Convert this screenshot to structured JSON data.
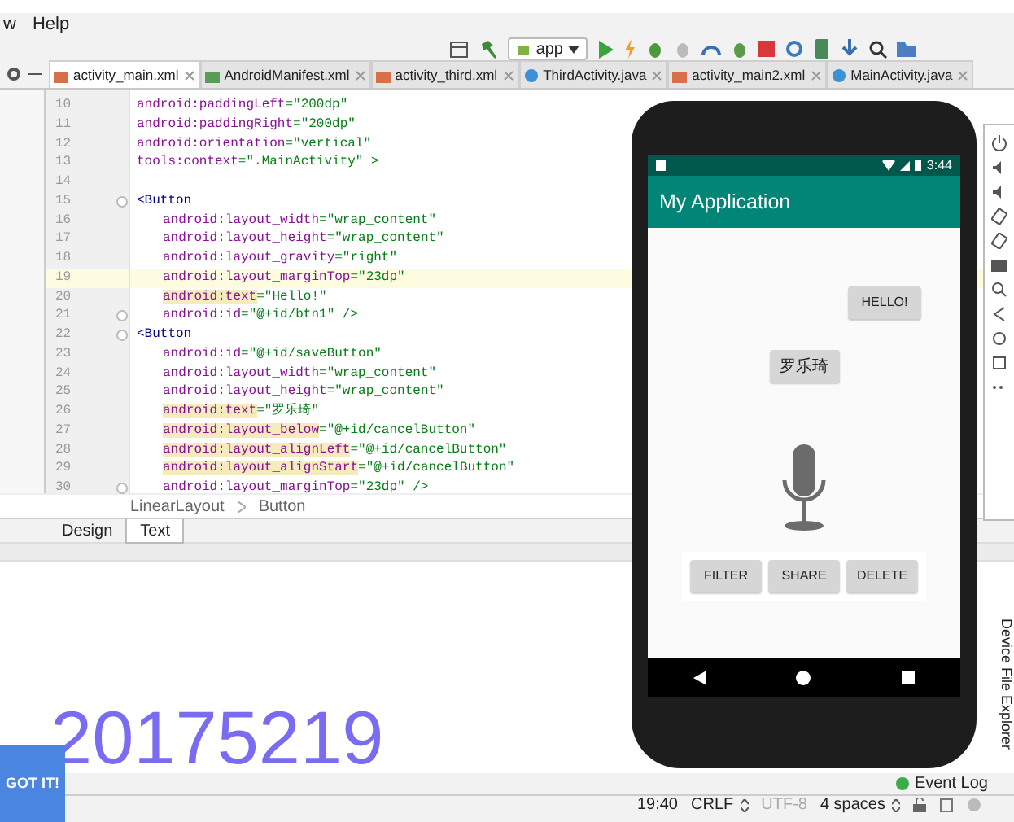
{
  "menu": [
    "w",
    "Help"
  ],
  "toolbar": {
    "run_config": "app"
  },
  "tabs": [
    {
      "label": "activity_main.xml",
      "kind": "layout",
      "selected": true
    },
    {
      "label": "AndroidManifest.xml",
      "kind": "manifest",
      "selected": false
    },
    {
      "label": "activity_third.xml",
      "kind": "layout",
      "selected": false
    },
    {
      "label": "ThirdActivity.java",
      "kind": "class",
      "selected": false
    },
    {
      "label": "activity_main2.xml",
      "kind": "layout",
      "selected": false
    },
    {
      "label": "MainActivity.java",
      "kind": "class",
      "selected": false
    }
  ],
  "code": [
    {
      "number": "10",
      "attr": "android:paddingLeft",
      "value": "=\"200dp\"",
      "current": false,
      "warning": false,
      "fold": false
    },
    {
      "number": "11",
      "attr": "android:paddingRight",
      "value": "=\"200dp\"",
      "current": false,
      "warning": false,
      "fold": false
    },
    {
      "number": "12",
      "attr": "android:orientation",
      "value": "=\"vertical\"",
      "current": false,
      "warning": false,
      "fold": false
    },
    {
      "number": "13",
      "attr": "tools:context",
      "value": "=\".MainActivity\" >",
      "current": false,
      "warning": false,
      "fold": false
    },
    {
      "number": "14"
    },
    {
      "number": "15",
      "tag": "<Button",
      "current": false,
      "warning": false,
      "fold": true,
      "children": [
        {
          "number": "16",
          "attr": "android:layout_width",
          "value": "=\"wrap_content\"",
          "current": false,
          "warning": false,
          "fold": false
        },
        {
          "number": "17",
          "attr": "android:layout_height",
          "value": "=\"wrap_content\"",
          "current": false,
          "warning": false,
          "fold": false
        },
        {
          "number": "18",
          "attr": "android:layout_gravity",
          "value": "=\"right\"",
          "current": false,
          "warning": false,
          "fold": false
        },
        {
          "number": "19",
          "attr": "android:layout_marginTop",
          "value": "=\"23dp\"",
          "current": true,
          "warning": false,
          "fold": false
        },
        {
          "number": "20",
          "attr": "android:text",
          "value": "=\"Hello!\"",
          "current": false,
          "warning": true,
          "fold": false
        },
        {
          "number": "21",
          "attr": "android:id",
          "value": "=\"@+id/btn1\"  />",
          "current": false,
          "warning": false,
          "fold": true
        }
      ]
    },
    {
      "number": "22",
      "tag": "<Button",
      "current": false,
      "warning": false,
      "fold": true,
      "children": [
        {
          "number": "23",
          "attr": "android:id",
          "value": "=\"@+id/saveButton\"",
          "current": false,
          "warning": false,
          "fold": false
        },
        {
          "number": "24",
          "attr": "android:layout_width",
          "value": "=\"wrap_content\"",
          "current": false,
          "warning": false,
          "fold": false
        },
        {
          "number": "25",
          "attr": "android:layout_height",
          "value": "=\"wrap_content\"",
          "current": false,
          "warning": false,
          "fold": false
        },
        {
          "number": "26",
          "attr": "android:text",
          "value": "=\"罗乐琦\"",
          "current": false,
          "warning": true,
          "fold": false
        },
        {
          "number": "27",
          "attr": "android:layout_below",
          "value": "=\"@+id/cancelButton\"",
          "current": false,
          "warning": true,
          "fold": false
        },
        {
          "number": "28",
          "attr": "android:layout_alignLeft",
          "value": "=\"@+id/cancelButton\"",
          "current": false,
          "warning": true,
          "fold": false
        },
        {
          "number": "29",
          "attr": "android:layout_alignStart",
          "value": "=\"@+id/cancelButton\"",
          "current": false,
          "warning": true,
          "fold": false
        },
        {
          "number": "30",
          "attr": "android:layout_marginTop",
          "value": "=\"23dp\" />",
          "current": false,
          "warning": false,
          "fold": true
        }
      ]
    }
  ],
  "breadcrumb": [
    "LinearLayout",
    "Button"
  ],
  "view_tabs": [
    {
      "label": "Design",
      "selected": false
    },
    {
      "label": "Text",
      "selected": true
    }
  ],
  "emulator": {
    "clock": "3:44",
    "app_title": "My Application",
    "hello_button": "HELLO!",
    "name_button": "罗乐琦",
    "action_buttons": [
      "FILTER",
      "SHARE",
      "DELETE"
    ]
  },
  "overlay_number": "20175219",
  "got_it": "GOT IT!",
  "event_log": "Event Log",
  "side_panel": "Device File Explorer",
  "status_bar": {
    "position": "19:40",
    "line_separator": "CRLF",
    "encoding": "UTF-8",
    "indent": "4 spaces"
  }
}
